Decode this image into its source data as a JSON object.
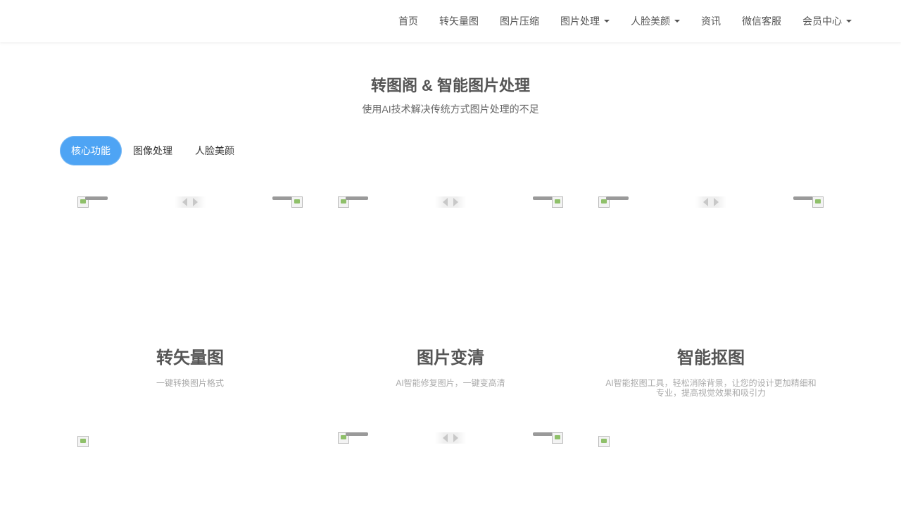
{
  "nav": {
    "items": [
      {
        "label": "首页",
        "dropdown": false
      },
      {
        "label": "转矢量图",
        "dropdown": false
      },
      {
        "label": "图片压缩",
        "dropdown": false
      },
      {
        "label": "图片处理",
        "dropdown": true
      },
      {
        "label": "人脸美颜",
        "dropdown": true
      },
      {
        "label": "资讯",
        "dropdown": false
      },
      {
        "label": "微信客服",
        "dropdown": false
      },
      {
        "label": "会员中心",
        "dropdown": true
      }
    ]
  },
  "hero": {
    "title": "转图阁 & 智能图片处理",
    "subtitle": "使用AI技术解决传统方式图片处理的不足"
  },
  "tabs": [
    {
      "label": "核心功能",
      "active": true
    },
    {
      "label": "图像处理",
      "active": false
    },
    {
      "label": "人脸美颜",
      "active": false
    }
  ],
  "cards": [
    {
      "title": "转矢量图",
      "desc": "一键转换图片格式"
    },
    {
      "title": "图片变清",
      "desc": "AI智能修复图片，一键变高清"
    },
    {
      "title": "智能抠图",
      "desc": "AI智能抠图工具，轻松消除背景，让您的设计更加精细和专业，提高视觉效果和吸引力"
    }
  ],
  "colors": {
    "accent": "#4ea4f4",
    "text": "#555555",
    "muted": "#aaaaaa"
  },
  "icons": {
    "broken_image": "broken-image-icon",
    "arrow_left": "chevron-left-icon",
    "arrow_right": "chevron-right-icon",
    "caret": "caret-down-icon"
  }
}
